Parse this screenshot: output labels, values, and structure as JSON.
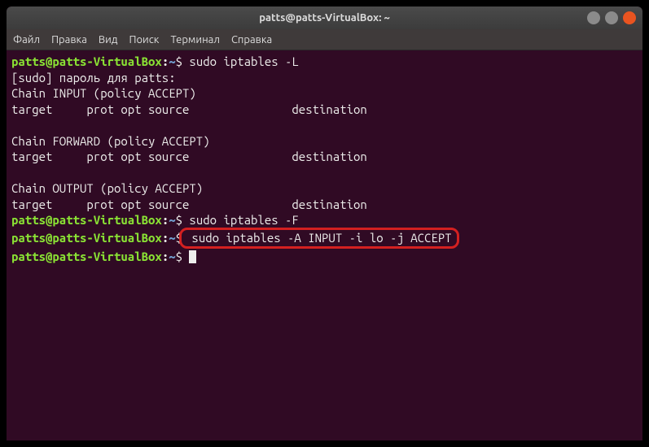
{
  "window": {
    "title": "patts@patts-VirtualBox: ~"
  },
  "menu": {
    "file": "Файл",
    "edit": "Правка",
    "view": "Вид",
    "search": "Поиск",
    "terminal": "Терминал",
    "help": "Справка"
  },
  "prompt": {
    "userhost": "patts@patts-VirtualBox",
    "colon": ":",
    "path": "~",
    "dollar": "$"
  },
  "terminal": {
    "cmd1": " sudo iptables -L",
    "line_sudo": "[sudo] пароль для patts:",
    "line_chain_input": "Chain INPUT (policy ACCEPT)",
    "line_header": "target     prot opt source               destination",
    "line_chain_forward": "Chain FORWARD (policy ACCEPT)",
    "line_chain_output": "Chain OUTPUT (policy ACCEPT)",
    "cmd2": " sudo iptables -F",
    "cmd3": " sudo iptables -A INPUT -i lo -j ACCEPT",
    "cmd4": " "
  }
}
